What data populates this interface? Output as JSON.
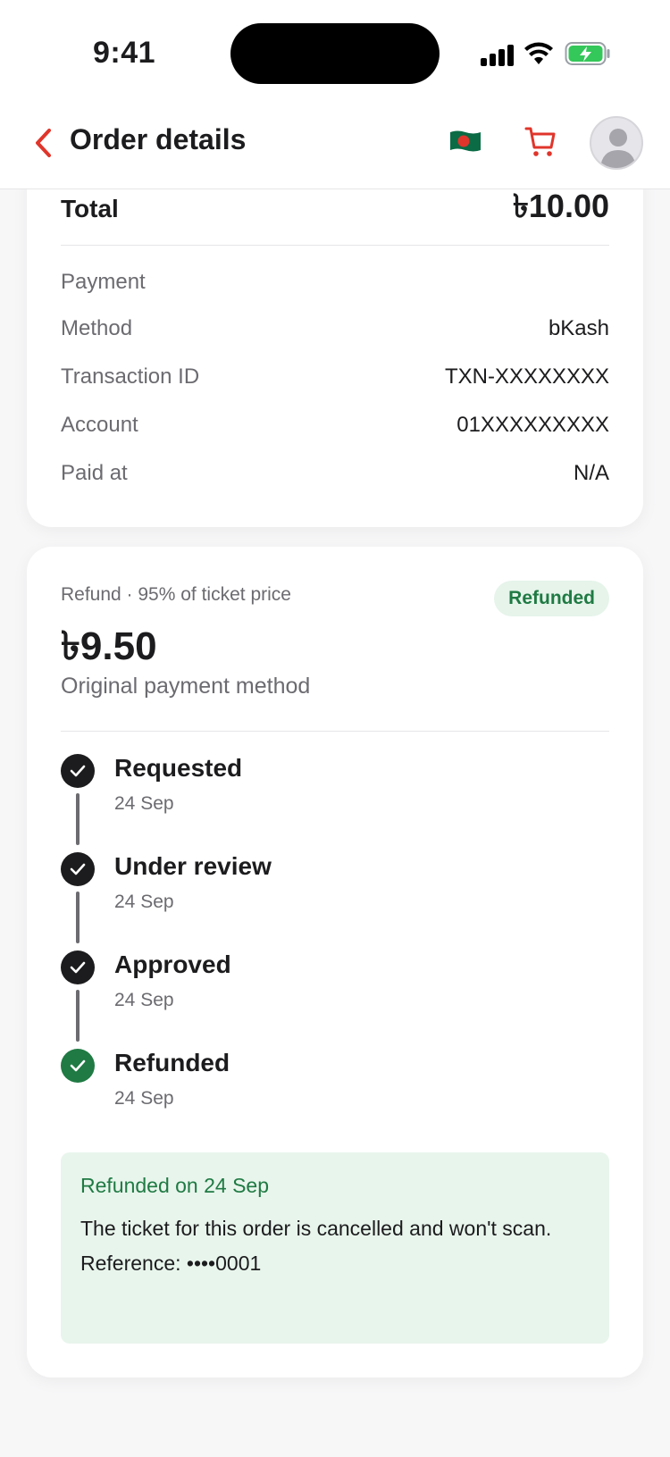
{
  "status_bar": {
    "time": "9:41"
  },
  "header": {
    "title": "Order details",
    "flag_icon": "bangladesh-flag-icon",
    "cart_icon": "cart-icon",
    "avatar_icon": "user-avatar-icon"
  },
  "summary": {
    "total_label": "Total",
    "total_value": "৳10.00"
  },
  "payment": {
    "section_label": "Payment",
    "rows": [
      {
        "label": "Method",
        "value": "bKash"
      },
      {
        "label": "Transaction ID",
        "value": "TXN-XXXXXXXX"
      },
      {
        "label": "Account",
        "value": "01XXXXXXXXX"
      },
      {
        "label": "Paid at",
        "value": "N/A"
      }
    ]
  },
  "refund": {
    "caption": "Refund · 95% of ticket price",
    "badge": "Refunded",
    "amount": "৳9.50",
    "method": "Original payment method",
    "steps": [
      {
        "title": "Requested",
        "date": "24 Sep",
        "status": "done"
      },
      {
        "title": "Under review",
        "date": "24 Sep",
        "status": "done"
      },
      {
        "title": "Approved",
        "date": "24 Sep",
        "status": "done"
      },
      {
        "title": "Refunded",
        "date": "24 Sep",
        "status": "complete"
      }
    ],
    "notice": {
      "title": "Refunded on 24 Sep",
      "body": "The ticket for this order is cancelled and won't scan.",
      "reference": "Reference: ••••0001"
    }
  },
  "colors": {
    "accent": "#e0352b",
    "success": "#1f7a43",
    "success_bg": "#e8f5ec"
  }
}
